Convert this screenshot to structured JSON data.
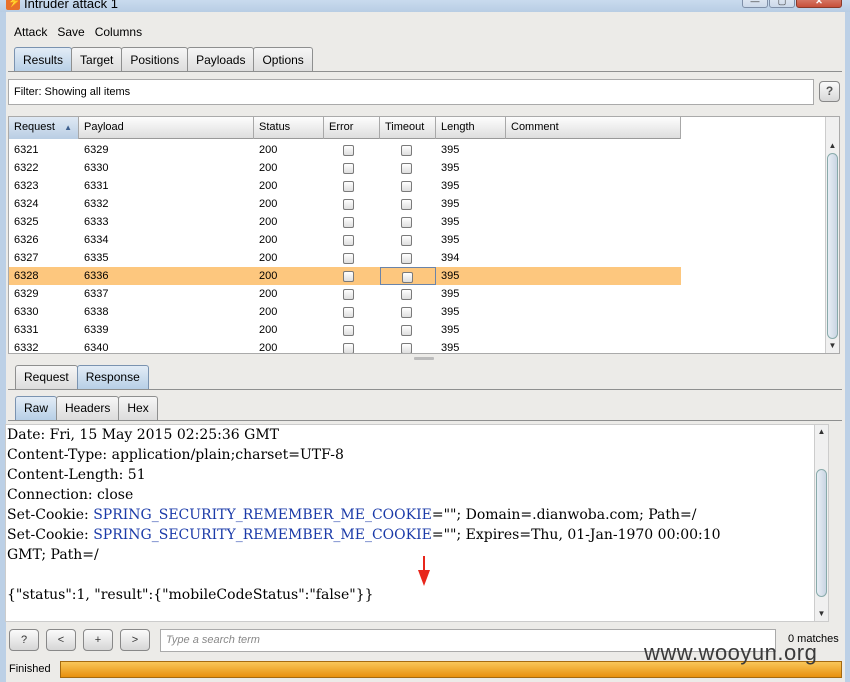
{
  "window": {
    "title": "Intruder attack 1",
    "min_glyph": "—",
    "max_glyph": "▢",
    "close_glyph": "✕"
  },
  "menu": [
    "Attack",
    "Save",
    "Columns"
  ],
  "main_tabs": [
    "Results",
    "Target",
    "Positions",
    "Payloads",
    "Options"
  ],
  "filter": {
    "text": "Filter: Showing all items",
    "help": "?"
  },
  "table": {
    "columns": [
      "Request",
      "Payload",
      "Status",
      "Error",
      "Timeout",
      "Length",
      "Comment"
    ],
    "sorted_column": "Request",
    "selected_request": "6328",
    "rows": [
      [
        "6321",
        "6329",
        "200",
        "395"
      ],
      [
        "6322",
        "6330",
        "200",
        "395"
      ],
      [
        "6323",
        "6331",
        "200",
        "395"
      ],
      [
        "6324",
        "6332",
        "200",
        "395"
      ],
      [
        "6325",
        "6333",
        "200",
        "395"
      ],
      [
        "6326",
        "6334",
        "200",
        "395"
      ],
      [
        "6327",
        "6335",
        "200",
        "394"
      ],
      [
        "6328",
        "6336",
        "200",
        "395"
      ],
      [
        "6329",
        "6337",
        "200",
        "395"
      ],
      [
        "6330",
        "6338",
        "200",
        "395"
      ],
      [
        "6331",
        "6339",
        "200",
        "395"
      ],
      [
        "6332",
        "6340",
        "200",
        "395"
      ]
    ]
  },
  "rr_tabs": [
    "Request",
    "Response"
  ],
  "view_tabs": [
    "Raw",
    "Headers",
    "Hex"
  ],
  "response": {
    "date": "Date: Fri, 15 May 2015 02:25:36 GMT",
    "content_type": "Content-Type: application/plain;charset=UTF-8",
    "content_length": "Content-Length: 51",
    "connection": "Connection: close",
    "cookie1_prefix": "Set-Cookie: ",
    "cookie1_name": "SPRING_SECURITY_REMEMBER_ME_COOKIE",
    "cookie1_eq": "=\"\"",
    "cookie1_rest": "; Domain=.dianwoba.com; Path=/",
    "cookie2_prefix": "Set-Cookie: ",
    "cookie2_name": "SPRING_SECURITY_REMEMBER_ME_COOKIE",
    "cookie2_eq": "=\"\"",
    "cookie2_rest": "; Expires=Thu, 01-Jan-1970 00:00:10",
    "cookie2_cont": "GMT; Path=/",
    "body": "{\"status\":1, \"result\":{\"mobileCodeStatus\":\"false\"}}"
  },
  "search": {
    "help": "?",
    "prev": "<",
    "add": "+",
    "next": ">",
    "placeholder": "Type a search term",
    "matches": "0 matches"
  },
  "status": {
    "label": "Finished",
    "progress": 1.0
  },
  "watermark": "www.wooyun.org",
  "colors": {
    "selected_row": "#fdc77e",
    "progress": "#e8900f",
    "annotation_arrow": "#e8261b",
    "cookie_name": "#1a3aa8"
  }
}
